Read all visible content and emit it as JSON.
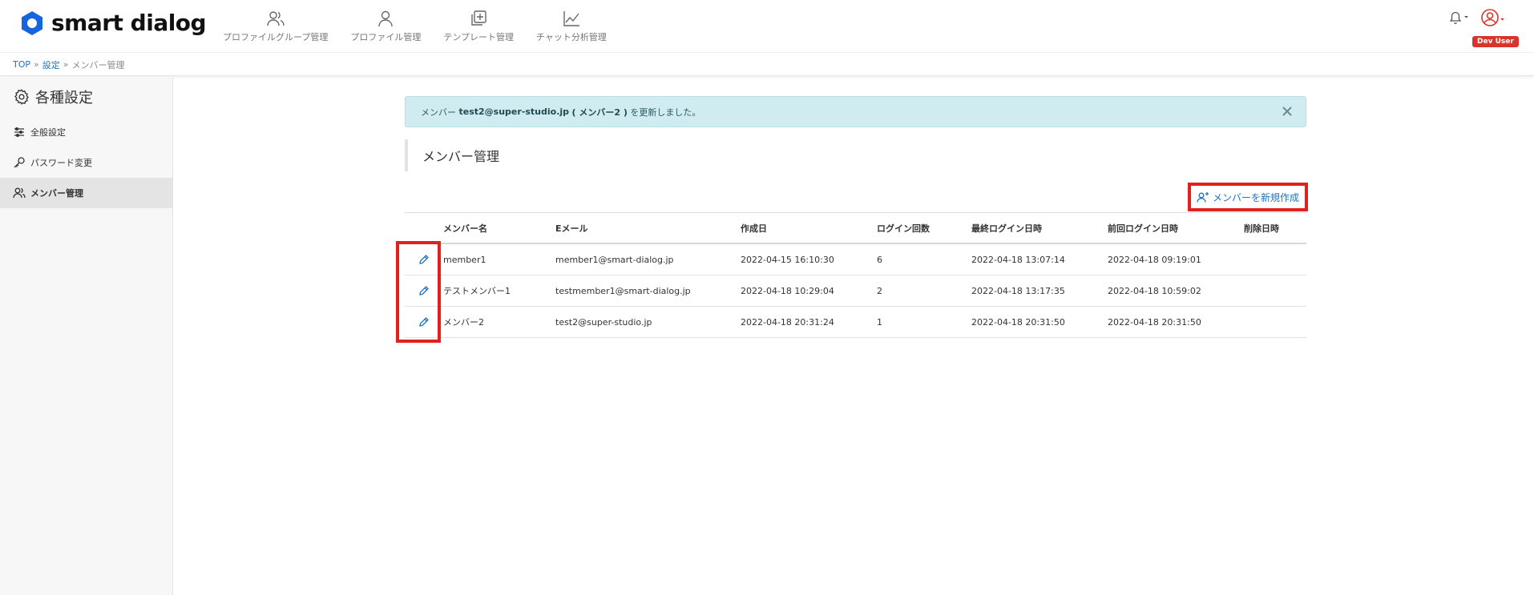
{
  "header": {
    "logo_text": "smart dialog",
    "nav": [
      {
        "icon": "users-icon",
        "label": "プロファイルグループ管理"
      },
      {
        "icon": "user-icon",
        "label": "プロファイル管理"
      },
      {
        "icon": "template-plus-icon",
        "label": "テンプレート管理"
      },
      {
        "icon": "chart-line-icon",
        "label": "チャット分析管理"
      }
    ],
    "user_badge": "Dev User"
  },
  "breadcrumb": {
    "top": "TOP",
    "sep1": "»",
    "settings": "設定",
    "sep2": "»",
    "current": "メンバー管理"
  },
  "sidebar": {
    "title": "各種設定",
    "items": [
      {
        "icon": "sliders-icon",
        "label": "全般設定"
      },
      {
        "icon": "key-icon",
        "label": "パスワード変更"
      },
      {
        "icon": "users-icon",
        "label": "メンバー管理"
      }
    ]
  },
  "alert": {
    "prefix": "メンバー",
    "email": "test2@super-studio.jp",
    "name": "( メンバー2 )",
    "suffix": "を更新しました。"
  },
  "section": {
    "title": "メンバー管理",
    "new_button": "メンバーを新規作成"
  },
  "table": {
    "headers": [
      "",
      "メンバー名",
      "Eメール",
      "作成日",
      "ログイン回数",
      "最終ログイン日時",
      "前回ログイン日時",
      "削除日時"
    ],
    "rows": [
      {
        "name": "member1",
        "email": "member1@smart-dialog.jp",
        "created": "2022-04-15 16:10:30",
        "logins": "6",
        "last_login": "2022-04-18 13:07:14",
        "prev_login": "2022-04-18 09:19:01",
        "deleted": ""
      },
      {
        "name": "テストメンバー1",
        "email": "testmember1@smart-dialog.jp",
        "created": "2022-04-18 10:29:04",
        "logins": "2",
        "last_login": "2022-04-18 13:17:35",
        "prev_login": "2022-04-18 10:59:02",
        "deleted": ""
      },
      {
        "name": "メンバー2",
        "email": "test2@super-studio.jp",
        "created": "2022-04-18 20:31:24",
        "logins": "1",
        "last_login": "2022-04-18 20:31:50",
        "prev_login": "2022-04-18 20:31:50",
        "deleted": ""
      }
    ]
  },
  "colors": {
    "link": "#1e73be",
    "highlight": "#e0211d",
    "alert_bg": "#d1ecf0",
    "brand": "#1565e0"
  }
}
